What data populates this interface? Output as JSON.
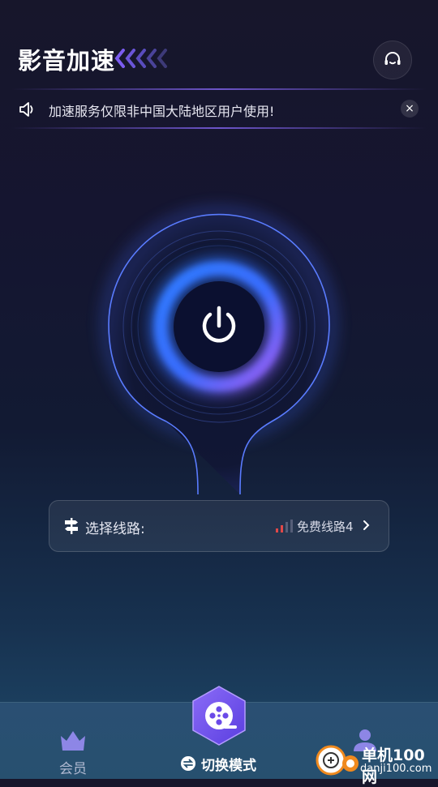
{
  "header": {
    "title": "影音加速"
  },
  "notice": {
    "text": "加速服务仅限非中国大陆地区用户使用!",
    "close_label": "×"
  },
  "route": {
    "label": "选择线路:",
    "value": "免费线路4"
  },
  "tabs": {
    "member_label": "会员",
    "switch_label": "切换模式"
  },
  "watermark": {
    "title": "单机100网",
    "url": "danji100.com"
  },
  "colors": {
    "accent_purple": "#7b5cf0",
    "accent_blue": "#2f7bff",
    "signal_red": "#e04848"
  },
  "icons": [
    "headset-icon",
    "speaker-icon",
    "close-icon",
    "power-icon",
    "signpost-icon",
    "signal-icon",
    "chevron-right-icon",
    "crown-icon",
    "film-reel-icon",
    "switch-icon",
    "user-icon"
  ]
}
